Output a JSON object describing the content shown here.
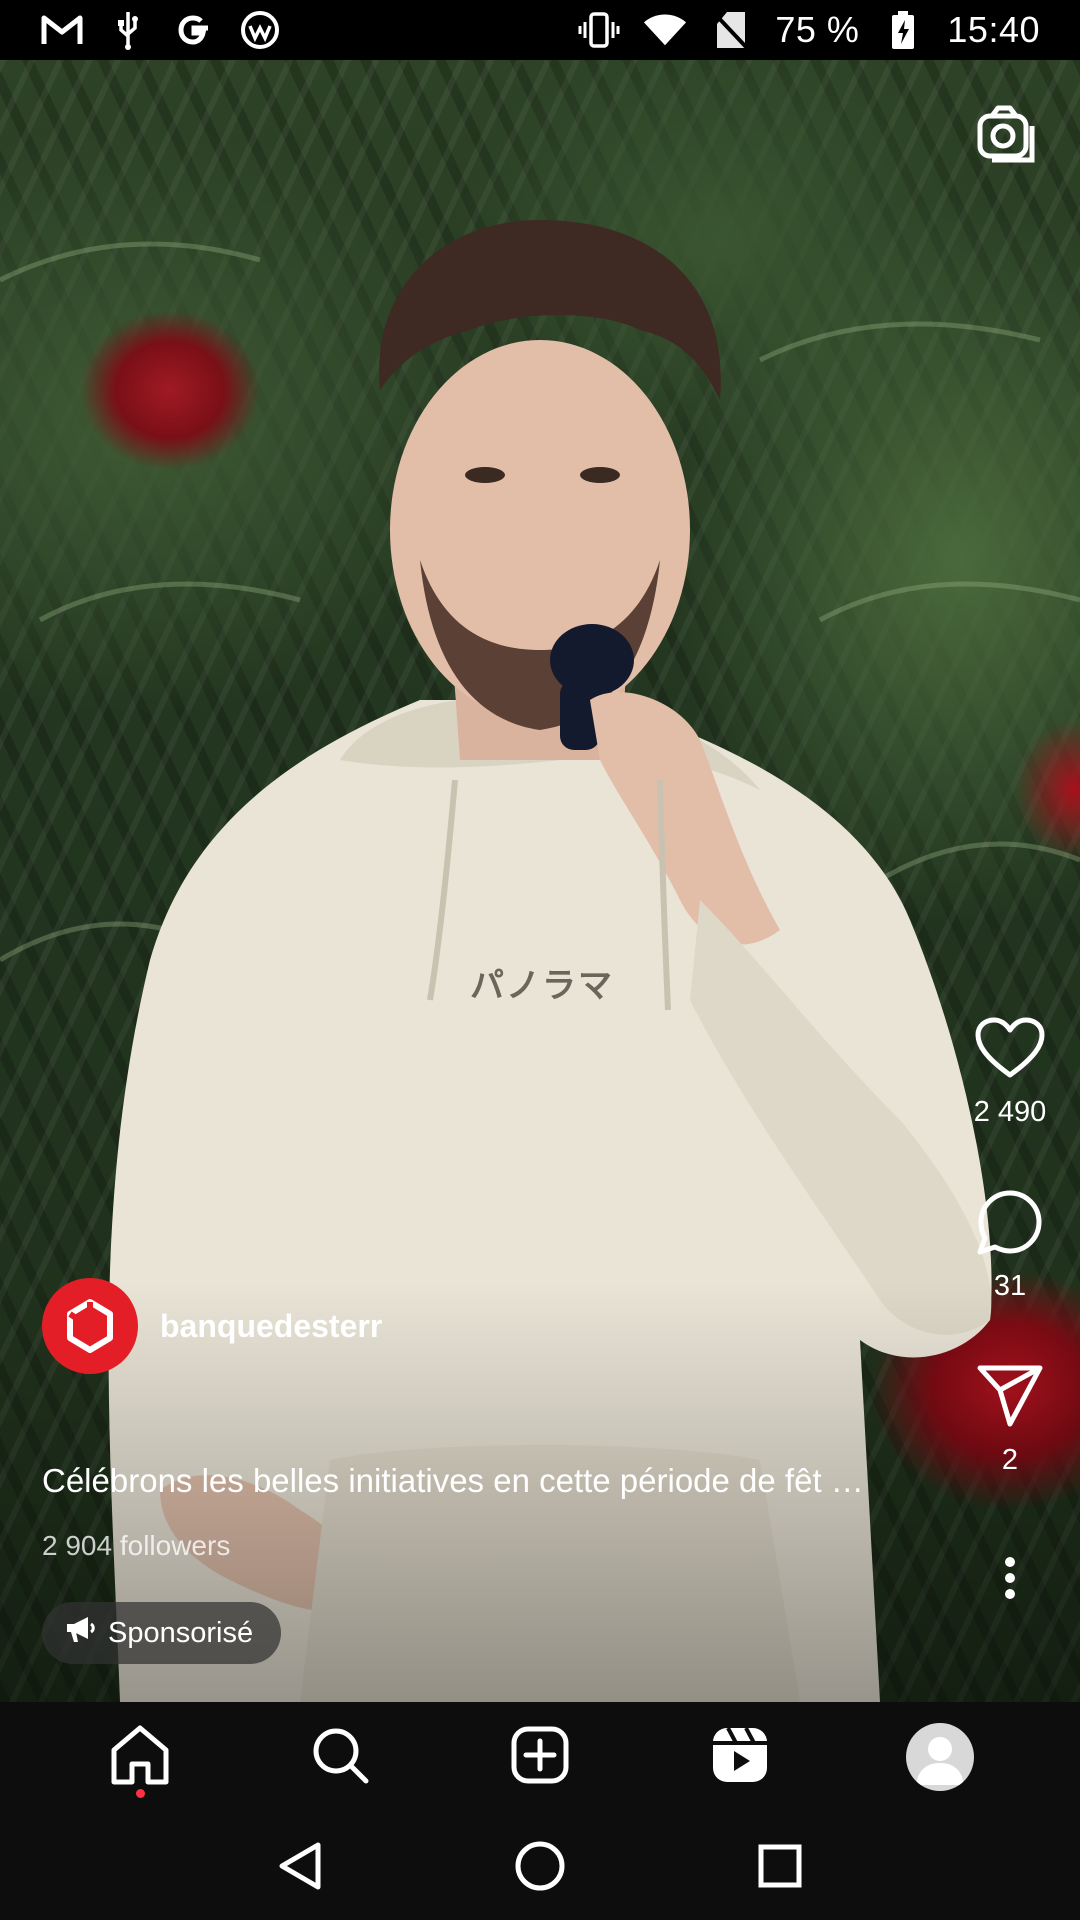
{
  "status_bar": {
    "battery": "75 %",
    "time": "15:40",
    "left_icons": [
      "gmail-icon",
      "usb-icon",
      "google-icon",
      "app-notification-icon"
    ],
    "right_icons": [
      "vibrate-icon",
      "wifi-icon",
      "no-sim-icon",
      "battery-charging-icon"
    ]
  },
  "reel": {
    "shirt_text": "パノラマ",
    "likes": "2 490",
    "comments": "31",
    "shares": "2",
    "author": "banquedesterr",
    "caption": "Célébrons les belles initiatives en cette période de fêt …",
    "followers": "2 904 followers",
    "sponsored_label": "Sponsorisé",
    "brand_color": "#e41e26"
  },
  "tabbar": {
    "items": [
      "home-icon",
      "search-icon",
      "create-icon",
      "reels-icon",
      "profile-avatar"
    ],
    "notification_dot_color": "#ff3040"
  },
  "navbar": {
    "items": [
      "back-icon",
      "home-circle-icon",
      "recents-icon"
    ]
  }
}
